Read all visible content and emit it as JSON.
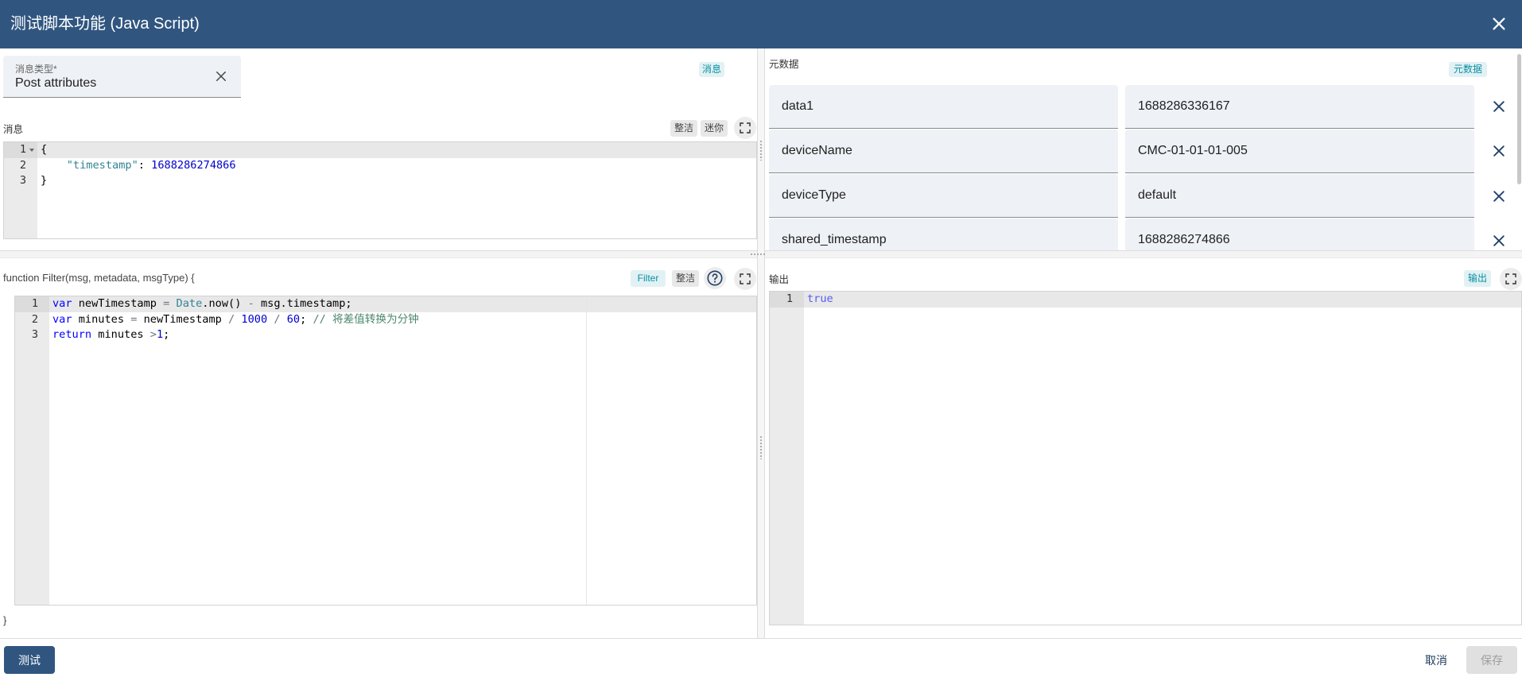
{
  "colors": {
    "header": "#305680",
    "accent": "#0a8fa3",
    "chip_bg": "#e2f1f4",
    "field_bg": "#eef1f5",
    "icon": "#22406a"
  },
  "dialog": {
    "title": "测试脚本功能 (Java Script)",
    "close_icon": "close-icon"
  },
  "message_type": {
    "label": "消息类型*",
    "value": "Post attributes",
    "clear_icon": "close-icon"
  },
  "message": {
    "chip": "消息",
    "label": "消息",
    "tidy": "整洁",
    "mini": "迷你",
    "fullscreen_icon": "fullscreen-icon",
    "lines": [
      "{",
      "    \"timestamp\": 1688286274866",
      "}"
    ]
  },
  "script": {
    "signature": "function Filter(msg, metadata, msgType) {",
    "closing": "}",
    "chip": "Filter",
    "tidy": "整洁",
    "help_icon": "help-icon",
    "fullscreen_icon": "fullscreen-icon",
    "lines": [
      "var newTimestamp = Date.now() - msg.timestamp;",
      "var minutes = newTimestamp / 1000 / 60; // 将差值转换为分钟",
      "return minutes >1;"
    ]
  },
  "metadata": {
    "label": "元数据",
    "chip": "元数据",
    "delete_icon": "close-icon",
    "rows": [
      {
        "key": "data1",
        "value": "1688286336167"
      },
      {
        "key": "deviceName",
        "value": "CMC-01-01-01-005"
      },
      {
        "key": "deviceType",
        "value": "default"
      },
      {
        "key": "shared_timestamp",
        "value": "1688286274866"
      }
    ]
  },
  "output": {
    "label": "输出",
    "chip": "输出",
    "fullscreen_icon": "fullscreen-icon",
    "lines": [
      "true"
    ]
  },
  "footer": {
    "test": "测试",
    "cancel": "取消",
    "save": "保存"
  }
}
